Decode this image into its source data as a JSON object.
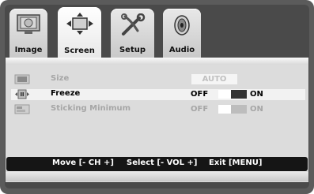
{
  "tabs": [
    {
      "label": "Image",
      "icon": "monitor-icon"
    },
    {
      "label": "Screen",
      "icon": "screen-arrows-icon"
    },
    {
      "label": "Setup",
      "icon": "tools-icon"
    },
    {
      "label": "Audio",
      "icon": "speaker-icon"
    }
  ],
  "active_tab": "Screen",
  "rows": [
    {
      "label": "Size",
      "value": "AUTO",
      "enabled": false,
      "highlighted": false
    },
    {
      "label": "Freeze",
      "off_label": "OFF",
      "on_label": "ON",
      "state": "ON",
      "enabled": true,
      "highlighted": true
    },
    {
      "label": "Sticking Minimum",
      "off_label": "OFF",
      "on_label": "ON",
      "state": "ON",
      "enabled": false,
      "highlighted": false
    }
  ],
  "footer": {
    "move": "Move [- CH +]",
    "select": "Select [- VOL +]",
    "exit": "Exit [MENU]"
  },
  "colors": {
    "frame": "#5b5b5b",
    "panel": "#dcdcdc",
    "footer_bg": "#151515",
    "dim_text": "#a6a6a6"
  }
}
